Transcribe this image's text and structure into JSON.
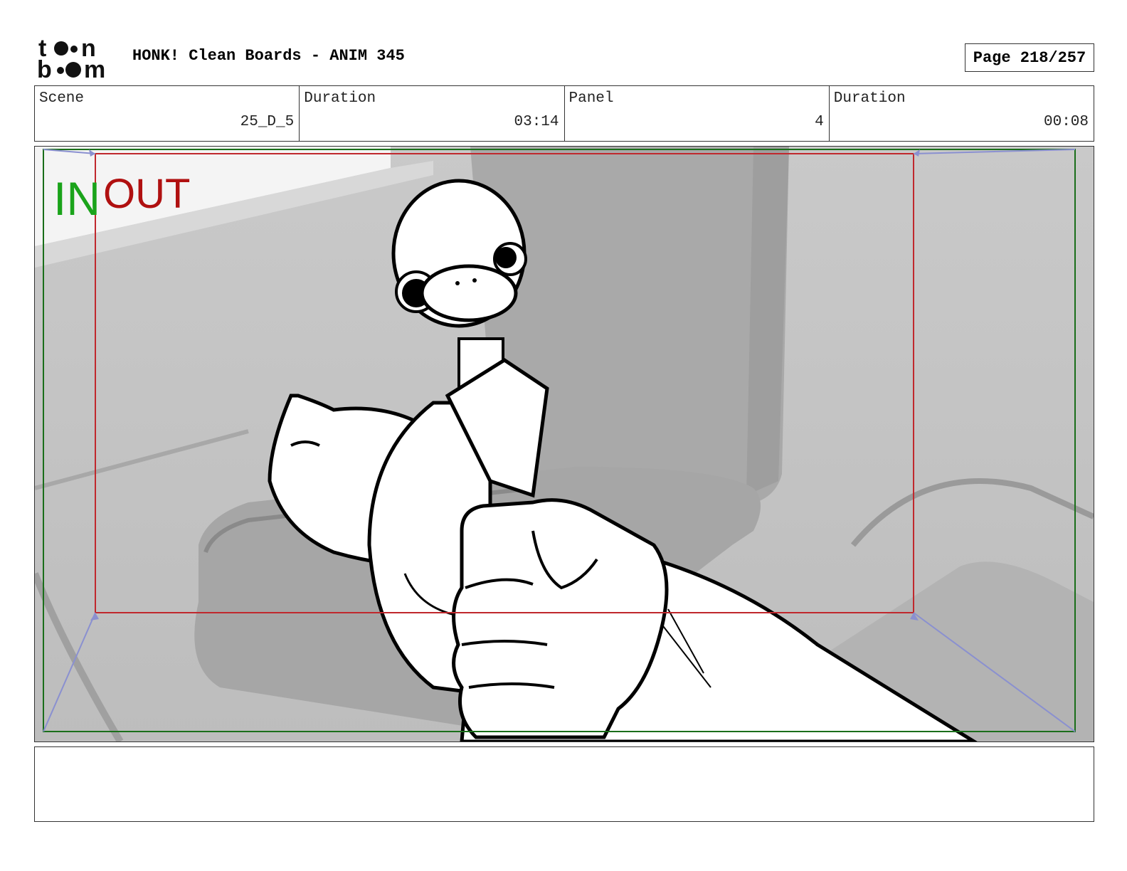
{
  "header": {
    "logo_text": "toon boom",
    "title": "HONK! Clean Boards - ANIM 345",
    "page": "Page 218/257"
  },
  "info": {
    "scene_label": "Scene",
    "scene_value": "25_D_5",
    "scene_duration_label": "Duration",
    "scene_duration_value": "03:14",
    "panel_label": "Panel",
    "panel_value": "4",
    "panel_duration_label": "Duration",
    "panel_duration_value": "00:08"
  },
  "panel": {
    "in_label": "IN",
    "out_label": "OUT",
    "in_color": "#1aa31a",
    "out_color": "#b01010",
    "in_frame_color": "#1a6e1a",
    "out_frame_color": "#c0282d",
    "camera_guide_color": "#8a90d0"
  },
  "caption": {
    "text": ""
  }
}
